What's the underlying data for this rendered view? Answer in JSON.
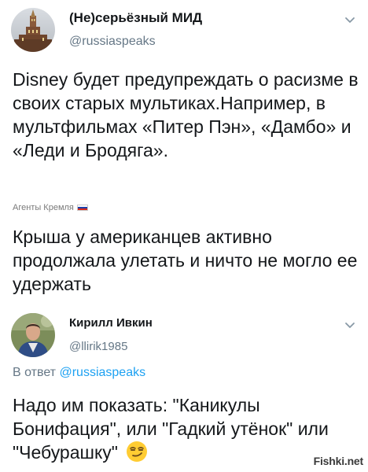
{
  "tweet1": {
    "author_name": "(Не)серьёзный МИД",
    "author_handle": "@russiaspeaks",
    "text": "Disney будет предупреждать о расизме в своих старых мультиках.Например, в мультфильмах «Питер Пэн», «Дамбо» и «Леди и Бродяга».",
    "source_label": "Агенты Кремля",
    "menu_icon": "chevron-down-icon"
  },
  "caption": {
    "text": "Крыша у американцев активно продолжала улетать и ничто не могло ее удержать"
  },
  "tweet2": {
    "author_name": "Кирилл Ивкин",
    "author_handle": "@llirik1985",
    "reply_prefix": "В ответ",
    "reply_to": "@russiaspeaks",
    "text": "Надо им показать: \"Каникулы Бонифация\", или \"Гадкий утёнок\" или \"Чебурашку\"",
    "emoji": "smirking-face-emoji",
    "menu_icon": "chevron-down-icon"
  },
  "watermark": "Fishki.net",
  "colors": {
    "text": "#14171a",
    "secondary": "#657786",
    "link": "#1da1f2",
    "flag_white": "#ffffff",
    "flag_blue": "#1c3fa8",
    "flag_red": "#d52b1e"
  }
}
